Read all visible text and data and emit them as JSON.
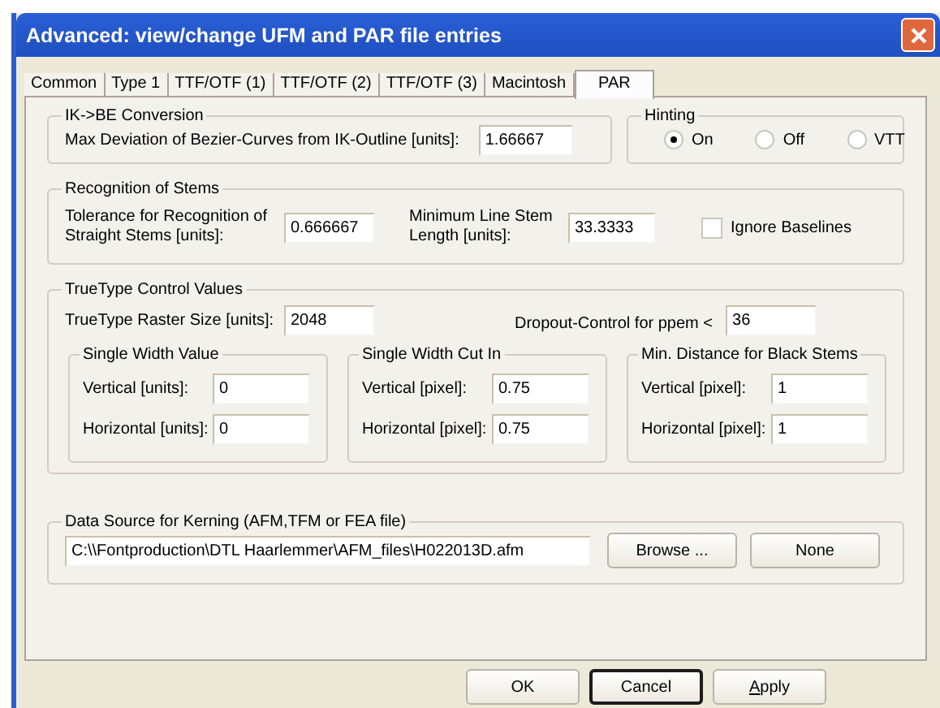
{
  "window": {
    "title": "Advanced: view/change UFM and PAR file entries"
  },
  "tabs": [
    {
      "label": "Common",
      "selected": false
    },
    {
      "label": "Type 1",
      "selected": false
    },
    {
      "label": "TTF/OTF (1)",
      "selected": false
    },
    {
      "label": "TTF/OTF (2)",
      "selected": false
    },
    {
      "label": "TTF/OTF (3)",
      "selected": false
    },
    {
      "label": "Macintosh",
      "selected": false
    },
    {
      "label": "PAR",
      "selected": true
    }
  ],
  "conversion": {
    "title": "IK->BE Conversion",
    "label": "Max Deviation of Bezier-Curves from IK-Outline [units]:",
    "value": "1.66667"
  },
  "hinting": {
    "title": "Hinting",
    "options": [
      {
        "label": "On",
        "selected": true
      },
      {
        "label": "Off",
        "selected": false
      },
      {
        "label": "VTT",
        "selected": false
      }
    ]
  },
  "stems": {
    "title": "Recognition of Stems",
    "tolerance": {
      "label": "Tolerance for Recognition of Straight Stems [units]:",
      "value": "0.666667"
    },
    "min_length": {
      "label": "Minimum Line Stem Length [units]:",
      "value": "33.3333"
    },
    "ignore_baselines": {
      "label": "Ignore Baselines",
      "checked": false
    }
  },
  "control_values": {
    "title": "TrueType Control Values",
    "raster_size": {
      "label": "TrueType Raster Size [units]:",
      "value": "2048"
    },
    "dropout": {
      "label": "Dropout-Control for ppem <",
      "value": "36"
    },
    "groups": [
      {
        "title": "Single Width Value",
        "fields": [
          {
            "label": "Vertical [units]:",
            "value": "0"
          },
          {
            "label": "Horizontal [units]:",
            "value": "0"
          }
        ]
      },
      {
        "title": "Single Width Cut In",
        "fields": [
          {
            "label": "Vertical [pixel]:",
            "value": "0.75"
          },
          {
            "label": "Horizontal [pixel]:",
            "value": "0.75"
          }
        ]
      },
      {
        "title": "Min. Distance for Black Stems",
        "fields": [
          {
            "label": "Vertical [pixel]:",
            "value": "1"
          },
          {
            "label": "Horizontal [pixel]:",
            "value": "1"
          }
        ]
      }
    ]
  },
  "kerning": {
    "title": "Data Source for Kerning (AFM,TFM or FEA file)",
    "path": "C:\\\\Fontproduction\\DTL Haarlemmer\\AFM_files\\H022013D.afm",
    "buttons": [
      "Browse ...",
      "None"
    ]
  },
  "buttons": [
    {
      "label": "OK",
      "default": false,
      "mnemonic": false
    },
    {
      "label": "Cancel",
      "default": true,
      "mnemonic": false
    },
    {
      "label": "Apply",
      "default": false,
      "mnemonic": true
    }
  ]
}
